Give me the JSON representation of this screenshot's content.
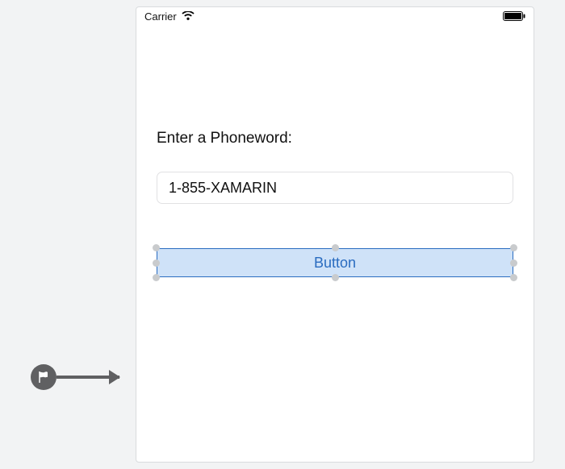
{
  "status_bar": {
    "carrier": "Carrier"
  },
  "form": {
    "prompt_label": "Enter a Phoneword:",
    "phone_value": "1-855-XAMARIN",
    "button_label": "Button"
  }
}
